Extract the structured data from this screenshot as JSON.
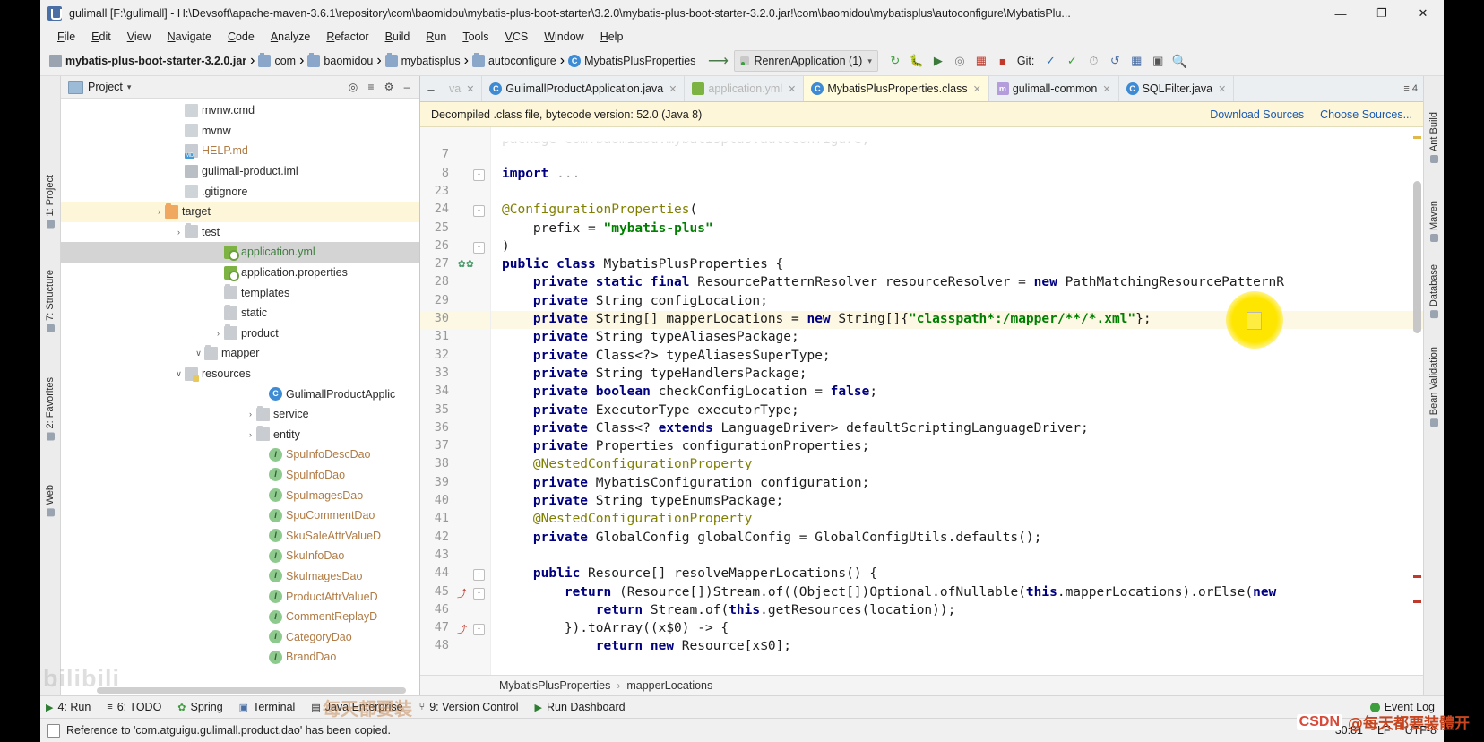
{
  "window": {
    "title": "gulimall [F:\\gulimall] - H:\\Devsoft\\apache-maven-3.6.1\\repository\\com\\baomidou\\mybatis-plus-boot-starter\\3.2.0\\mybatis-plus-boot-starter-3.2.0.jar!\\com\\baomidou\\mybatisplus\\autoconfigure\\MybatisPlu...",
    "minimize": "—",
    "maximize": "❐",
    "close": "✕"
  },
  "menu": [
    "File",
    "Edit",
    "View",
    "Navigate",
    "Code",
    "Analyze",
    "Refactor",
    "Build",
    "Run",
    "Tools",
    "VCS",
    "Window",
    "Help"
  ],
  "navbar": {
    "breadcrumbs": [
      {
        "label": "mybatis-plus-boot-starter-3.2.0.jar",
        "icon": "jar-icon",
        "bold": true
      },
      {
        "label": "com",
        "icon": "package-icon",
        "bold": false
      },
      {
        "label": "baomidou",
        "icon": "package-icon",
        "bold": false
      },
      {
        "label": "mybatisplus",
        "icon": "package-icon",
        "bold": false
      },
      {
        "label": "autoconfigure",
        "icon": "package-icon",
        "bold": false
      },
      {
        "label": "MybatisPlusProperties",
        "icon": "class-icon",
        "bold": false
      }
    ],
    "back_icon": "back-arrow-icon",
    "run_config": "RenrenApplication (1)",
    "run_config_caret": "▾",
    "toolbar_icons": [
      "rerun-icon",
      "debug-icon",
      "run-with-coverage-icon",
      "profile-icon",
      "build-icon",
      "stop-icon"
    ],
    "git_label": "Git:",
    "git_icons": [
      "update-project-icon",
      "commit-icon",
      "history-icon",
      "rollback-icon"
    ],
    "extra_icons": [
      "structure-icon",
      "preview-icon",
      "search-icon"
    ]
  },
  "project": {
    "header_title": "Project",
    "header_caret": "▾",
    "header_icons": [
      "locate-icon",
      "collapse-all-icon",
      "settings-icon",
      "hide-icon"
    ],
    "tree": [
      {
        "label": "BrandDao",
        "icon": "interface-icon",
        "indent": 14,
        "arrow": "",
        "color": "orange"
      },
      {
        "label": "CategoryDao",
        "icon": "interface-icon",
        "indent": 14,
        "arrow": "",
        "color": "orange"
      },
      {
        "label": "CommentReplayD",
        "icon": "interface-icon",
        "indent": 14,
        "arrow": "",
        "color": "orange"
      },
      {
        "label": "ProductAttrValueD",
        "icon": "interface-icon",
        "indent": 14,
        "arrow": "",
        "color": "orange"
      },
      {
        "label": "SkuImagesDao",
        "icon": "interface-icon",
        "indent": 14,
        "arrow": "",
        "color": "orange"
      },
      {
        "label": "SkuInfoDao",
        "icon": "interface-icon",
        "indent": 14,
        "arrow": "",
        "color": "orange"
      },
      {
        "label": "SkuSaleAttrValueD",
        "icon": "interface-icon",
        "indent": 14,
        "arrow": "",
        "color": "orange"
      },
      {
        "label": "SpuCommentDao",
        "icon": "interface-icon",
        "indent": 14,
        "arrow": "",
        "color": "orange"
      },
      {
        "label": "SpuImagesDao",
        "icon": "interface-icon",
        "indent": 14,
        "arrow": "",
        "color": "orange"
      },
      {
        "label": "SpuInfoDao",
        "icon": "interface-icon",
        "indent": 14,
        "arrow": "",
        "color": "orange"
      },
      {
        "label": "SpuInfoDescDao",
        "icon": "interface-icon",
        "indent": 14,
        "arrow": "",
        "color": "orange"
      },
      {
        "label": "entity",
        "icon": "folder-icon",
        "indent": 0,
        "arrow": "›",
        "color": ""
      },
      {
        "label": "service",
        "icon": "folder-icon",
        "indent": 0,
        "arrow": "›",
        "color": ""
      },
      {
        "label": "GulimallProductApplic",
        "icon": "class-icon",
        "indent": 14,
        "arrow": "",
        "color": ""
      },
      {
        "label": "resources",
        "icon": "resources-folder-icon",
        "indent": -80,
        "arrow": "∨",
        "color": ""
      },
      {
        "label": "mapper",
        "icon": "folder-icon",
        "indent": -58,
        "arrow": "∨",
        "color": ""
      },
      {
        "label": "product",
        "icon": "folder-icon",
        "indent": -36,
        "arrow": "›",
        "color": ""
      },
      {
        "label": "static",
        "icon": "folder-icon",
        "indent": -36,
        "arrow": "",
        "color": ""
      },
      {
        "label": "templates",
        "icon": "folder-icon",
        "indent": -36,
        "arrow": "",
        "color": ""
      },
      {
        "label": "application.properties",
        "icon": "yaml-file-icon",
        "indent": -36,
        "arrow": "",
        "color": ""
      },
      {
        "label": "application.yml",
        "icon": "yaml-file-icon",
        "indent": -36,
        "arrow": "",
        "color": "green",
        "selected": true
      },
      {
        "label": "test",
        "icon": "folder-icon",
        "indent": -80,
        "arrow": "›",
        "color": ""
      },
      {
        "label": "target",
        "icon": "target-folder-icon",
        "indent": -102,
        "arrow": "›",
        "color": "",
        "highlight": true
      },
      {
        "label": ".gitignore",
        "icon": "text-file-icon",
        "indent": -80,
        "arrow": "",
        "color": ""
      },
      {
        "label": "gulimall-product.iml",
        "icon": "iml-file-icon",
        "indent": -80,
        "arrow": "",
        "color": ""
      },
      {
        "label": "HELP.md",
        "icon": "markdown-file-icon",
        "indent": -80,
        "arrow": "",
        "color": "orange"
      },
      {
        "label": "mvnw",
        "icon": "file-icon",
        "indent": -80,
        "arrow": "",
        "color": ""
      },
      {
        "label": "mvnw.cmd",
        "icon": "file-icon",
        "indent": -80,
        "arrow": "",
        "color": ""
      }
    ]
  },
  "left_strips": [
    {
      "label": "1: Project",
      "icon": "project-icon"
    },
    {
      "label": "7: Structure",
      "icon": "structure-icon"
    },
    {
      "label": "2: Favorites",
      "icon": "favorites-icon"
    },
    {
      "label": "Web",
      "icon": "web-icon"
    }
  ],
  "right_strips": [
    {
      "label": "Ant Build",
      "icon": "ant-icon"
    },
    {
      "label": "Maven",
      "icon": "maven-icon"
    },
    {
      "label": "Database",
      "icon": "database-icon"
    },
    {
      "label": "Bean Validation",
      "icon": "bean-icon"
    }
  ],
  "editor": {
    "tabs": [
      {
        "label": "va",
        "icon": "",
        "state": "faded",
        "close": "✕"
      },
      {
        "label": "GulimallProductApplication.java",
        "icon": "java-class-icon",
        "state": "normal",
        "close": "✕"
      },
      {
        "label": "application.yml",
        "icon": "yaml-file-icon",
        "state": "faded",
        "close": "✕"
      },
      {
        "label": "MybatisPlusProperties.class",
        "icon": "java-class-icon",
        "state": "active",
        "close": "✕"
      },
      {
        "label": "gulimall-common",
        "icon": "maven-module-icon",
        "state": "normal",
        "close": "✕"
      },
      {
        "label": "SQLFilter.java",
        "icon": "java-class-icon",
        "state": "normal",
        "close": "✕"
      }
    ],
    "collapse_icon": "collapse-icon",
    "notification": {
      "text": "Decompiled .class file, bytecode version: 52.0 (Java 8)",
      "links": [
        "Download Sources",
        "Choose Sources..."
      ]
    },
    "lines": [
      {
        "n": "",
        "html": "partial"
      },
      {
        "n": "7",
        "html": ""
      },
      {
        "n": "8",
        "html": "<span class='kw'>import</span> <span class='grey'>...</span>",
        "fold": "-"
      },
      {
        "n": "23",
        "html": ""
      },
      {
        "n": "24",
        "html": "<span class='an'>@ConfigurationProperties</span>(",
        "fold": "-"
      },
      {
        "n": "25",
        "html": "    prefix = <span class='st'>\"mybatis-plus\"</span>"
      },
      {
        "n": "26",
        "html": ")",
        "fold": "-"
      },
      {
        "n": "27",
        "html": "<span class='kw'>public class</span> MybatisPlusProperties {",
        "gutter": "beans"
      },
      {
        "n": "28",
        "html": "    <span class='kw'>private static final</span> ResourcePatternResolver resourceResolver = <span class='kw'>new</span> PathMatchingResourcePatternR"
      },
      {
        "n": "29",
        "html": "    <span class='kw'>private</span> String configLocation;"
      },
      {
        "n": "30",
        "html": "    <span class='kw'>private</span> String[] mapperLocations = <span class='kw'>new</span> String[]{<span class='st'>\"classpath*:/mapper/**/*.xml\"</span>};",
        "highlight": true
      },
      {
        "n": "31",
        "html": "    <span class='kw'>private</span> String typeAliasesPackage;"
      },
      {
        "n": "32",
        "html": "    <span class='kw'>private</span> Class&lt;?&gt; typeAliasesSuperType;"
      },
      {
        "n": "33",
        "html": "    <span class='kw'>private</span> String typeHandlersPackage;"
      },
      {
        "n": "34",
        "html": "    <span class='kw'>private boolean</span> checkConfigLocation = <span class='kw'>false</span>;"
      },
      {
        "n": "35",
        "html": "    <span class='kw'>private</span> ExecutorType executorType;"
      },
      {
        "n": "36",
        "html": "    <span class='kw'>private</span> Class&lt;? <span class='kw'>extends</span> LanguageDriver&gt; defaultScriptingLanguageDriver;"
      },
      {
        "n": "37",
        "html": "    <span class='kw'>private</span> Properties configurationProperties;"
      },
      {
        "n": "38",
        "html": "    <span class='an'>@NestedConfigurationProperty</span>"
      },
      {
        "n": "39",
        "html": "    <span class='kw'>private</span> MybatisConfiguration configuration;"
      },
      {
        "n": "40",
        "html": "    <span class='kw'>private</span> String typeEnumsPackage;"
      },
      {
        "n": "41",
        "html": "    <span class='an'>@NestedConfigurationProperty</span>"
      },
      {
        "n": "42",
        "html": "    <span class='kw'>private</span> GlobalConfig globalConfig = GlobalConfigUtils.defaults();"
      },
      {
        "n": "43",
        "html": ""
      },
      {
        "n": "44",
        "html": "    <span class='kw'>public</span> Resource[] resolveMapperLocations() {",
        "fold": "-"
      },
      {
        "n": "45",
        "html": "        <span class='kw'>return</span> (Resource[])Stream.of((Object[])Optional.ofNullable(<span class='kw'>this</span>.mapperLocations).orElse(<span class='kw'>new</span>",
        "mark": "warn",
        "fold": "-"
      },
      {
        "n": "46",
        "html": "            <span class='kw'>return</span> Stream.of(<span class='kw'>this</span>.getResources(location));"
      },
      {
        "n": "47",
        "html": "        }).toArray((x$0) -&gt; {",
        "mark": "warn",
        "fold": "-"
      },
      {
        "n": "48",
        "html": "            <span class='kw'>return new</span> Resource[x$0];"
      }
    ],
    "breadcrumb": [
      "MybatisPlusProperties",
      "mapperLocations"
    ],
    "breadcrumb_sep": "›"
  },
  "bottom_tools": [
    {
      "label": "4: Run",
      "icon": "run-icon"
    },
    {
      "label": "6: TODO",
      "icon": "todo-icon"
    },
    {
      "label": "Spring",
      "icon": "spring-icon"
    },
    {
      "label": "Terminal",
      "icon": "terminal-icon"
    },
    {
      "label": "Java Enterprise",
      "icon": "java-enterprise-icon"
    },
    {
      "label": "9: Version Control",
      "icon": "version-control-icon"
    },
    {
      "label": "Run Dashboard",
      "icon": "run-dashboard-icon"
    }
  ],
  "event_log": {
    "label": "Event Log",
    "icon": "event-log-icon"
  },
  "status": {
    "message": "Reference to 'com.atguigu.gulimall.product.dao' has been copied.",
    "position": "30:81",
    "line_separator": "LF",
    "encoding": "UTF-8"
  },
  "watermarks": {
    "bilibili": "bilibili",
    "csdn": "CSDN",
    "cn_text": "@每天都要装體开",
    "cn_faint": "每天都要装"
  },
  "colors": {
    "accent": "#3d8bd4",
    "highlight": "#fcf8e3",
    "notification_bg": "#fdf6d8",
    "keyword": "#000080",
    "string": "#008000",
    "annotation": "#808000"
  }
}
